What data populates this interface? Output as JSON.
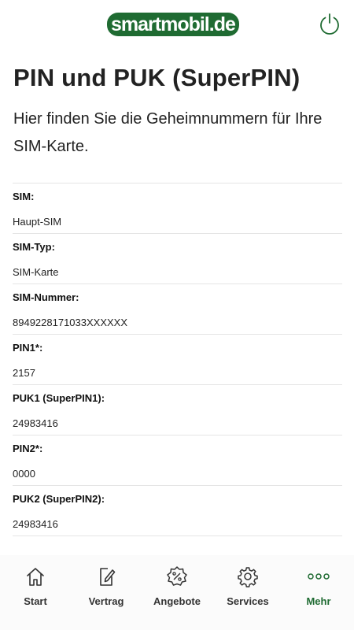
{
  "header": {
    "logo_text": "smartmobil.de",
    "brand_color": "#1f6b32",
    "power_icon": "power-icon"
  },
  "page": {
    "title": "PIN und PUK (SuperPIN)",
    "subtitle": "Hier finden Sie die Geheimnummern für Ihre SIM-Karte."
  },
  "details": [
    {
      "label": "SIM:",
      "value": "Haupt-SIM"
    },
    {
      "label": "SIM-Typ:",
      "value": "SIM-Karte"
    },
    {
      "label": "SIM-Nummer:",
      "value": "8949228171033XXXXXX"
    },
    {
      "label": "PIN1*:",
      "value": "2157"
    },
    {
      "label": "PUK1 (SuperPIN1):",
      "value": "24983416"
    },
    {
      "label": "PIN2*:",
      "value": "0000"
    },
    {
      "label": "PUK2 (SuperPIN2):",
      "value": "24983416"
    }
  ],
  "nav": {
    "items": [
      {
        "label": "Start",
        "icon": "home-icon"
      },
      {
        "label": "Vertrag",
        "icon": "contract-icon"
      },
      {
        "label": "Angebote",
        "icon": "percent-badge-icon"
      },
      {
        "label": "Services",
        "icon": "gear-icon"
      },
      {
        "label": "Mehr",
        "icon": "more-dots-icon",
        "active": true
      }
    ]
  }
}
